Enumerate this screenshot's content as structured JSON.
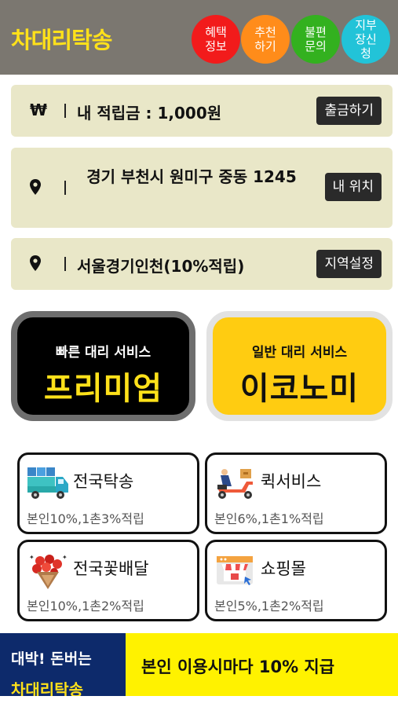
{
  "header": {
    "title": "차대리탁송",
    "buttons": [
      {
        "label": "혜택정보",
        "color": "#f21b1b"
      },
      {
        "label": "추천하기",
        "color": "#ff8c1a"
      },
      {
        "label": "불편문의",
        "color": "#33b11f"
      },
      {
        "label": "지부장신청",
        "color": "#22c3d8"
      }
    ]
  },
  "info": {
    "points": {
      "icon": "₩",
      "text": "내 적립금 : 1,000원",
      "button": "출금하기"
    },
    "location": {
      "icon": "map-pin-icon",
      "text": "경기 부천시 원미구 중동 1245",
      "button": "내 위치"
    },
    "region": {
      "icon": "map-pin-icon",
      "text": "서울경기인천(10%적립)",
      "button": "지역설정"
    }
  },
  "services": {
    "premium": {
      "sub": "빠른 대리 서비스",
      "main": "프리미엄"
    },
    "economy": {
      "sub": "일반 대리 서비스",
      "main": "이코노미"
    }
  },
  "cards": [
    {
      "title": "전국탁송",
      "desc": "본인10%,1촌3%적립",
      "icon": "delivery-truck-icon"
    },
    {
      "title": "퀵서비스",
      "desc": "본인6%,1촌1%적립",
      "icon": "scooter-icon"
    },
    {
      "title": "전국꽃배달",
      "desc": "본인10%,1촌2%적립",
      "icon": "flower-bouquet-icon"
    },
    {
      "title": "쇼핑몰",
      "desc": "본인5%,1촌2%적립",
      "icon": "shop-icon"
    }
  ],
  "banner": {
    "left_line1": "대박! 돈버는",
    "left_line2": "차대리탁송",
    "right_text": "본인 이용시마다 10% 지급"
  },
  "colors": {
    "header_bg": "#7b7770",
    "accent_yellow": "#ffe11a",
    "info_bg": "#e9e7c8",
    "banner_navy": "#0d2a6b",
    "banner_yellow": "#fff200"
  }
}
